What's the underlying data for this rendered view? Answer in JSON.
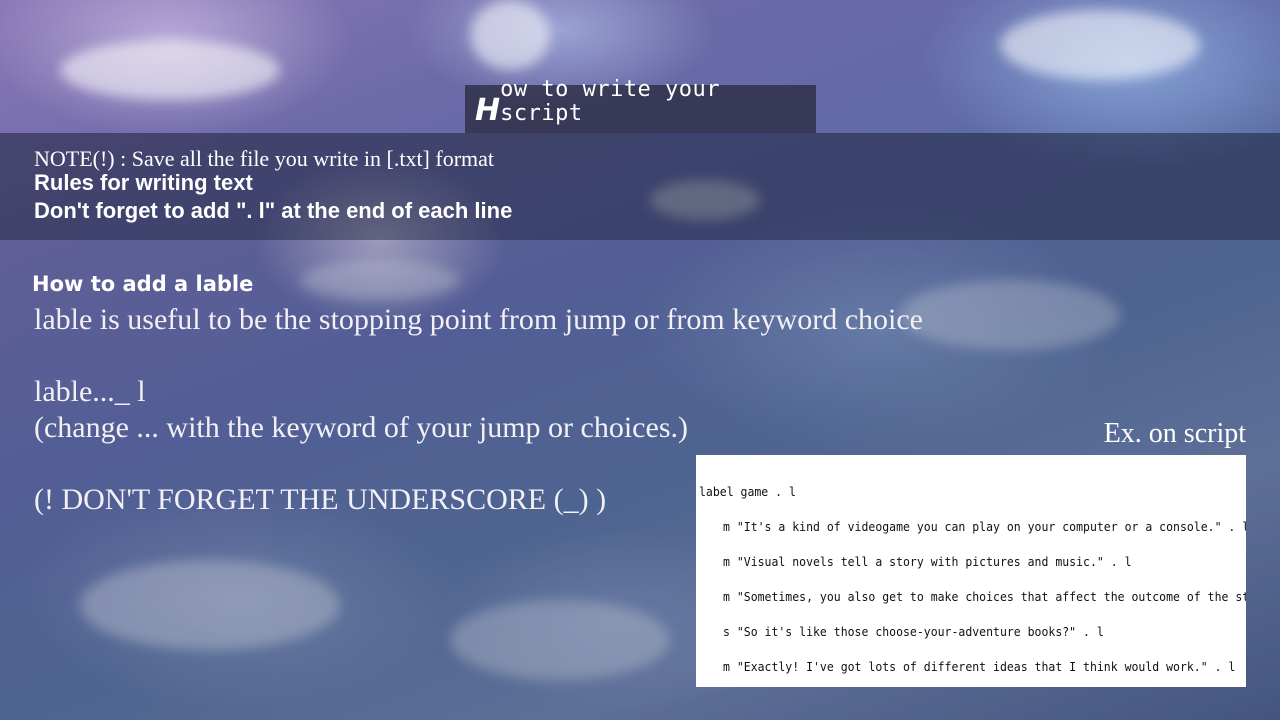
{
  "title": {
    "first_letter": "H",
    "rest": "ow to write your script"
  },
  "note": "NOTE(!) : Save all the file you write in [.txt] format",
  "rules": {
    "heading": "Rules for writing text",
    "body": "Don't forget to add \". l\" at the end of each line"
  },
  "lable_section": {
    "heading": "How to add a lable",
    "description": "lable is useful to be the stopping point from jump or from keyword choice",
    "syntax": "lable..._ l",
    "syntax_note": "(change ... with the keyword of your jump or choices.)",
    "warning": "(! DON'T FORGET THE  UNDERSCORE (_) )"
  },
  "example": {
    "label": "Ex. on script",
    "lines": [
      "label game . l",
      "m \"It's a kind of videogame you can play on your computer or a console.\" . l",
      "m \"Visual novels tell a story with pictures and music.\" . l",
      "m \"Sometimes, you also get to make choices that affect the outcome of the story.\" . l",
      "s \"So it's like those choose-your-adventure books?\" . l",
      "m \"Exactly! I've got lots of different ideas that I think would work.\" . l"
    ]
  }
}
